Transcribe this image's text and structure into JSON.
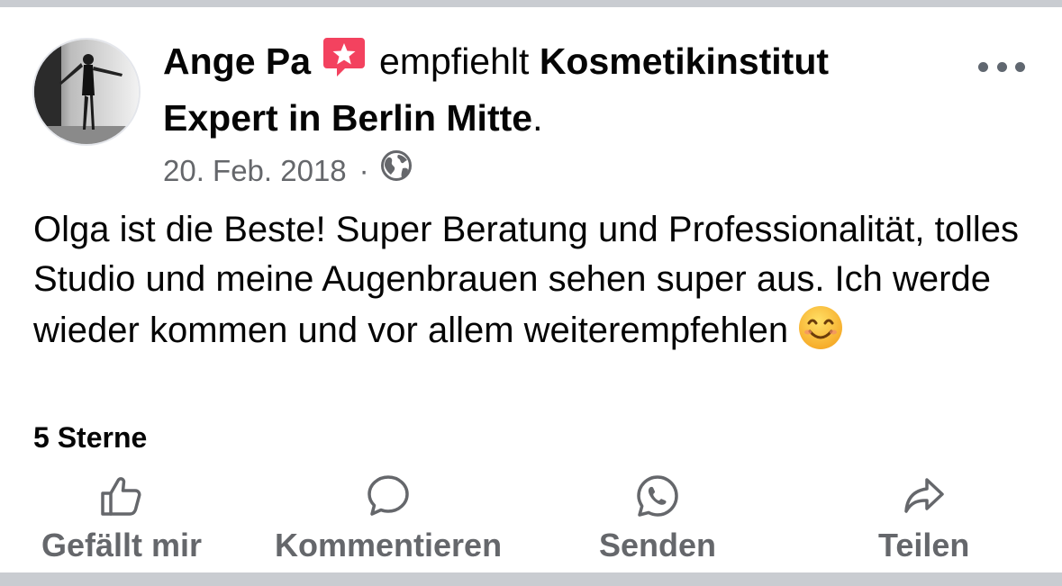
{
  "post": {
    "author": "Ange Pa",
    "badge_icon": "recommend-star-badge-icon",
    "verb": "empfiehlt",
    "page_name": "Kosmetikinstitut Expert in Berlin Mitte",
    "period": ".",
    "date": "20. Feb. 2018",
    "separator": "·",
    "privacy_icon": "globe-icon",
    "text": "Olga ist die Beste! Super Beratung und Professionalität, tolles Studio und meine Augenbrauen sehen super aus. Ich werde wieder kommen und vor allem weiterempfehlen",
    "emoji_icon": "smiling-face-emoji-icon",
    "rating": "5 Sterne",
    "more_icon": "more-options-icon"
  },
  "actions": [
    {
      "label": "Gefällt mir",
      "icon": "like-thumb-icon"
    },
    {
      "label": "Kommentieren",
      "icon": "comment-bubble-icon"
    },
    {
      "label": "Senden",
      "icon": "whatsapp-icon"
    },
    {
      "label": "Teilen",
      "icon": "share-arrow-icon"
    }
  ],
  "colors": {
    "text_primary": "#050505",
    "text_secondary": "#65676b",
    "badge_red": "#f3425f",
    "background_gray": "#c9ccd1"
  }
}
